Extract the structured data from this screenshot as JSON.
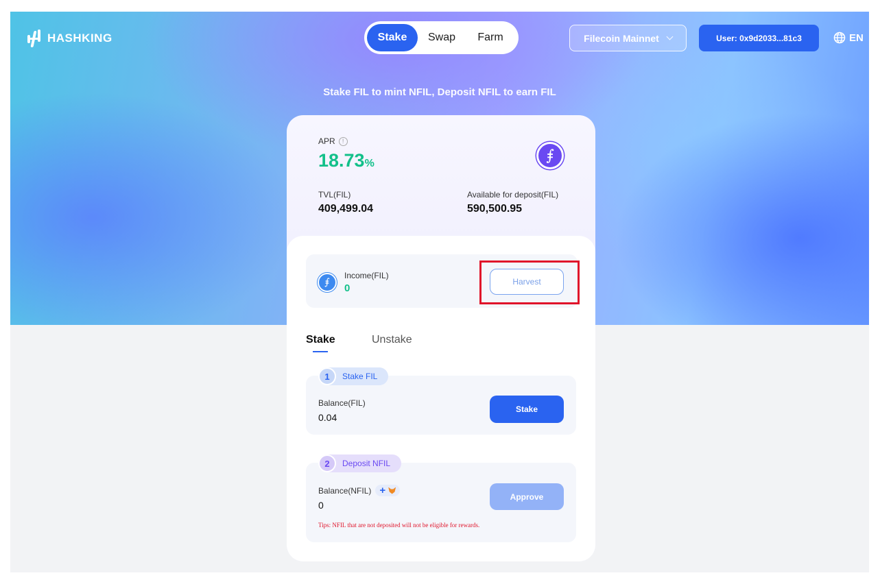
{
  "header": {
    "logo_text": "HASHKING",
    "nav": [
      {
        "label": "Stake",
        "active": true
      },
      {
        "label": "Swap",
        "active": false
      },
      {
        "label": "Farm",
        "active": false
      }
    ],
    "network_label": "Filecoin Mainnet",
    "user_label": "User: 0x9d2033...81c3",
    "language": "EN"
  },
  "hero": {
    "subtitle": "Stake FIL to mint NFIL, Deposit NFIL to earn FIL"
  },
  "stats": {
    "apr_label": "APR",
    "apr_value": "18.73",
    "apr_unit": "%",
    "tvl_label": "TVL(FIL)",
    "tvl_value": "409,499.04",
    "available_label": "Available for deposit(FIL)",
    "available_value": "590,500.95",
    "coin_symbol": "⨎"
  },
  "income": {
    "label": "Income(FIL)",
    "value": "0",
    "harvest_label": "Harvest"
  },
  "tabs": {
    "stake": "Stake",
    "unstake": "Unstake"
  },
  "step1": {
    "number": "1",
    "title": "Stake FIL",
    "balance_label": "Balance(FIL)",
    "balance_value": "0.04",
    "button_label": "Stake"
  },
  "step2": {
    "number": "2",
    "title": "Deposit NFIL",
    "balance_label": "Balance(NFIL)",
    "balance_value": "0",
    "button_label": "Approve",
    "tips": "Tips: NFIL that are not deposited will not be eligible for rewards."
  },
  "colors": {
    "accent": "#2a63f0",
    "apr_green": "#13c08a",
    "highlight_red": "#e0142a"
  }
}
